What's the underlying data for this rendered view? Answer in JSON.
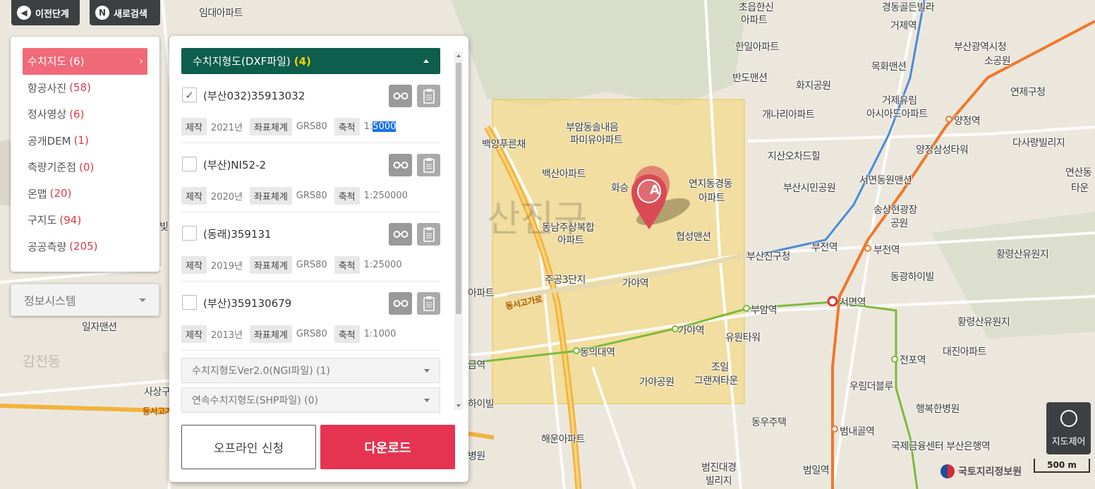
{
  "top_bar": {
    "prev_step_label": "이전단계",
    "new_search_label": "새로검색",
    "new_search_icon_letter": "N"
  },
  "categories": [
    {
      "name": "수치지도",
      "count": "(6)",
      "active": true
    },
    {
      "name": "항공사진",
      "count": "(58)"
    },
    {
      "name": "정사영상",
      "count": "(6)"
    },
    {
      "name": "공개DEM",
      "count": "(1)"
    },
    {
      "name": "측량기준점",
      "count": "(0)"
    },
    {
      "name": "온맵",
      "count": "(20)"
    },
    {
      "name": "구지도",
      "count": "(94)"
    },
    {
      "name": "공공측량",
      "count": "(205)"
    }
  ],
  "info_system_select": "정보시스템",
  "detail": {
    "section_title": "수치지형도(DXF파일)",
    "section_count": "(4)",
    "tag_labels": {
      "made": "제작",
      "coord": "좌표체계",
      "scale": "축척"
    },
    "entries": [
      {
        "name": "(부산032)35913032",
        "checked": true,
        "year": "2021년",
        "coord": "GRS80",
        "scale_prefix": "1:",
        "scale_value": "5000",
        "scale_highlighted": true
      },
      {
        "name": "(부산)NI52-2",
        "checked": false,
        "year": "2020년",
        "coord": "GRS80",
        "scale_prefix": "1:",
        "scale_value": "250000"
      },
      {
        "name": "(동래)359131",
        "checked": false,
        "year": "2019년",
        "coord": "GRS80",
        "scale_prefix": "1:",
        "scale_value": "25000"
      },
      {
        "name": "(부산)359130679",
        "checked": false,
        "year": "2013년",
        "coord": "GRS80",
        "scale_prefix": "1:",
        "scale_value": "1000"
      }
    ],
    "sub_sections": [
      {
        "label": "수치지형도Ver2.0(NGI파일) (1)"
      },
      {
        "label": "연속수치지형도(SHP파일) (0)"
      }
    ],
    "offline_button": "오프라인 신청",
    "download_button": "다운로드"
  },
  "map": {
    "marker_letter": "A",
    "labels": [
      "임대아파트",
      "초읍한신",
      "아파트",
      "한일아파트",
      "반도맨션",
      "경동골든빌라",
      "거제역",
      "부산광역시청",
      "소공원",
      "목화맨션",
      "화지공원",
      "연제구청",
      "거제유림",
      "아시아드아파트",
      "개나리아파트",
      "양정역",
      "다사랑빌리지",
      "백양푸른채",
      "부암동솔내음",
      "파미유아파트",
      "지산오차드힐",
      "양정삼성타워",
      "백산아파트",
      "화승",
      "연지동경동",
      "아파트",
      "서면동원맨션",
      "부산시민공원",
      "송상현광장",
      "공원",
      "동남주상복합",
      "아파트",
      "협성맨션",
      "부전역",
      "부전역",
      "부산진구청",
      "황령산유원지",
      "주공3단지",
      "가야역",
      "동광하이빌",
      "서면역",
      "부암역",
      "일자맨션",
      "가야역",
      "유원타워",
      "동의대역",
      "황령산유원지",
      "대진아파트",
      "전포역",
      "가야공원",
      "조일",
      "그랜져타운",
      "우림더블루",
      "행복한병원",
      "동우주택",
      "범내골역",
      "국제금융센터 부산은행역",
      "해운아파트",
      "범진대경",
      "빌리지",
      "범일역",
      "사상구",
      "하이빌",
      "연산동",
      "타운",
      "금역",
      "아파트",
      "병원",
      "동서고가로",
      "동서고가로",
      "산진구",
      "감전동",
      "빛"
    ],
    "ngii_label": "국토지리정보원",
    "scale_label": "500 m",
    "map_control_label": "지도제어"
  },
  "colors": {
    "panel_header": "#0d5e4c",
    "active_category": "#f06a7a",
    "count_red": "#d93a49",
    "download_button": "#e63352",
    "highlight_count": "#f4d000",
    "selection_box": "#f5d76e"
  }
}
